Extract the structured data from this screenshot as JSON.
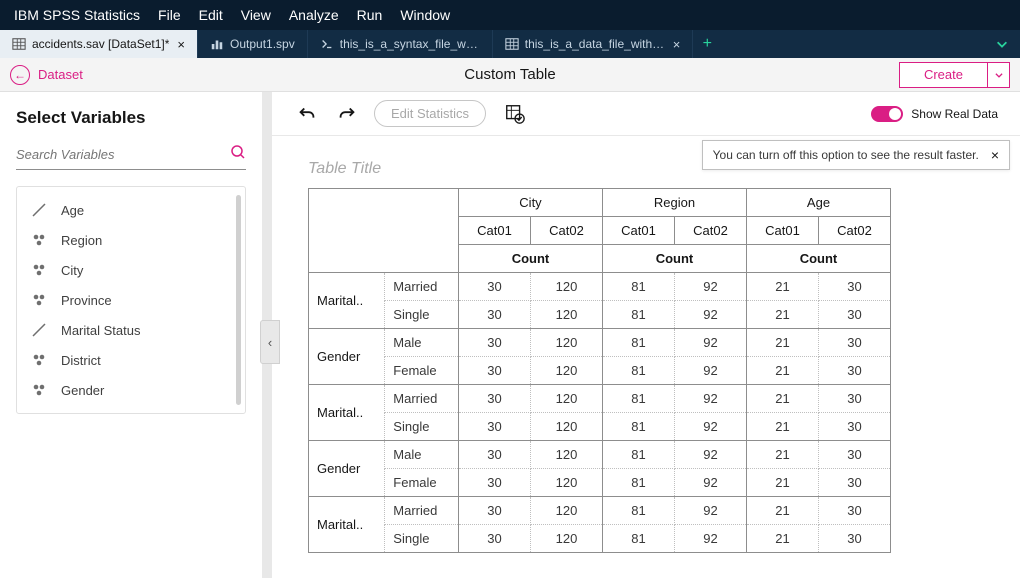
{
  "menubar": {
    "brand": "IBM SPSS Statistics",
    "items": [
      "File",
      "Edit",
      "View",
      "Analyze",
      "Run",
      "Window"
    ]
  },
  "tabs": [
    {
      "label": "accidents.sav [DataSet1]*",
      "icon": "table",
      "active": true,
      "close": true
    },
    {
      "label": "Output1.spv",
      "icon": "bar",
      "active": false,
      "close": false
    },
    {
      "label": "this_is_a_syntax_file_with_a_lo…",
      "icon": "prompt",
      "active": false,
      "close": false
    },
    {
      "label": "this_is_a_data_file_with_a_long",
      "icon": "table",
      "active": false,
      "close": true
    }
  ],
  "subheader": {
    "back_label": "Dataset",
    "title": "Custom Table",
    "create_label": "Create"
  },
  "left": {
    "heading": "Select Variables",
    "search_placeholder": "Search Variables",
    "vars": [
      {
        "name": "Age",
        "type": "scale"
      },
      {
        "name": "Region",
        "type": "nominal"
      },
      {
        "name": "City",
        "type": "nominal"
      },
      {
        "name": "Province",
        "type": "nominal"
      },
      {
        "name": "Marital Status",
        "type": "scale"
      },
      {
        "name": "District",
        "type": "nominal"
      },
      {
        "name": "Gender",
        "type": "nominal"
      }
    ]
  },
  "toolbar": {
    "edit_stats": "Edit Statistics",
    "real_data": "Show Real Data"
  },
  "tooltip": {
    "text": "You can turn off this option to see the result faster."
  },
  "table": {
    "title_placeholder": "Table Title",
    "col_groups": [
      "City",
      "Region",
      "Age"
    ],
    "col_cats": [
      "Cat01",
      "Cat02"
    ],
    "count_label": "Count",
    "row_groups": [
      {
        "label": "Marital..",
        "subs": [
          "Married",
          "Single"
        ]
      },
      {
        "label": "Gender",
        "subs": [
          "Male",
          "Female"
        ]
      },
      {
        "label": "Marital..",
        "subs": [
          "Married",
          "Single"
        ]
      },
      {
        "label": "Gender",
        "subs": [
          "Male",
          "Female"
        ]
      },
      {
        "label": "Marital..",
        "subs": [
          "Married",
          "Single"
        ]
      }
    ],
    "row_values": [
      30,
      120,
      81,
      92,
      21,
      30
    ]
  }
}
